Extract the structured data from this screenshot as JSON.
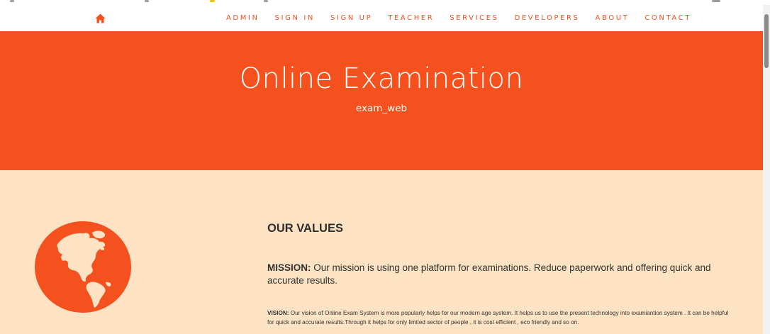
{
  "navbar": {
    "home_icon": "home-icon",
    "links": [
      "ADMIN",
      "SIGN IN",
      "SIGN UP",
      "TEACHER",
      "SERVICES",
      "DEVELOPERS",
      "ABOUT",
      "CONTACT"
    ]
  },
  "hero": {
    "title": "Online Examination",
    "subtitle": "exam_web"
  },
  "values": {
    "heading": "OUR VALUES",
    "mission_label": "MISSION:",
    "mission_text": " Our mission is using one platform for examinations. Reduce paperwork and offering quick and accurate results.",
    "vision_label": "VISION:",
    "vision_text": " Our vision of Online Exam System is more popularly helps for our modern age system. It helps us to use the present technology into examiantion system . It can be helpful for quick and accurate results.Through it helps for only limited sector of people , it is cost efficient , eco friendly and so on.",
    "globe_icon": "globe-icon"
  },
  "colors": {
    "accent": "#f4511e",
    "section_bg": "#fde3c3",
    "text": "#333333"
  }
}
